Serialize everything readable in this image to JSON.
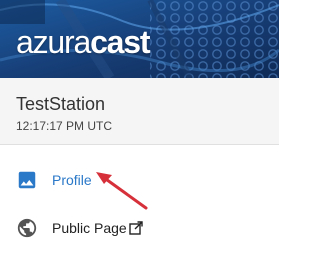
{
  "header": {
    "logo_part1": "azura",
    "logo_part2": "cast"
  },
  "station": {
    "name": "TestStation",
    "time": "12:17:17 PM UTC"
  },
  "nav": {
    "items": [
      {
        "label": "Profile",
        "icon": "image-icon",
        "color": "#2a78c8",
        "active": true
      },
      {
        "label": "Public Page",
        "icon": "globe-icon",
        "trailing_icon": "external-link-icon"
      }
    ]
  },
  "annotation": {
    "arrow_color": "#d6303a"
  }
}
